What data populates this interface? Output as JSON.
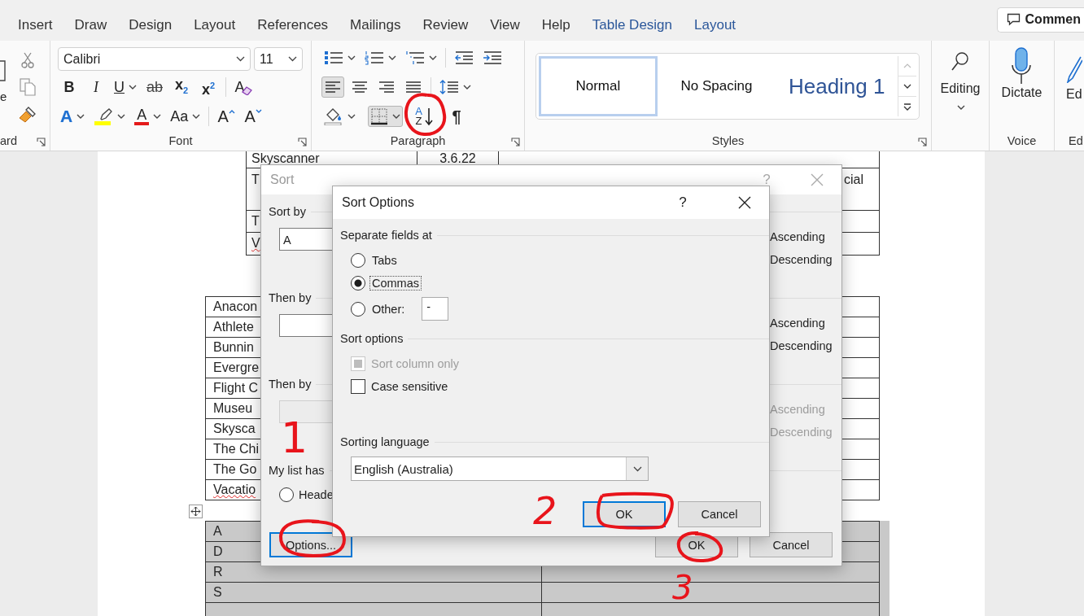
{
  "ribbon_tabs": [
    {
      "label": "Insert",
      "contextual": false
    },
    {
      "label": "Draw",
      "contextual": false
    },
    {
      "label": "Design",
      "contextual": false
    },
    {
      "label": "Layout",
      "contextual": false
    },
    {
      "label": "References",
      "contextual": false
    },
    {
      "label": "Mailings",
      "contextual": false
    },
    {
      "label": "Review",
      "contextual": false
    },
    {
      "label": "View",
      "contextual": false
    },
    {
      "label": "Help",
      "contextual": false
    },
    {
      "label": "Table Design",
      "contextual": true
    },
    {
      "label": "Layout",
      "contextual": true
    }
  ],
  "comments_button": {
    "label": "Commen"
  },
  "ribbon": {
    "clipboard": {
      "paste_label": "e",
      "group_label": "ard"
    },
    "font": {
      "font_name": "Calibri",
      "font_size": "11",
      "group_label": "Font",
      "row_1": [
        {
          "kind": "bold",
          "label": "B",
          "menu": false
        },
        {
          "kind": "italic",
          "label": "I",
          "menu": false
        },
        {
          "kind": "underline",
          "label": "U",
          "menu": true
        },
        {
          "kind": "strike",
          "label": "ab",
          "menu": false
        },
        {
          "kind": "subscript",
          "label": "x$_{2}$",
          "menu": false
        },
        {
          "kind": "superscript",
          "label": "x$^{2}$",
          "menu": false
        },
        {
          "kind": "clear_format",
          "label": "A",
          "menu": false
        }
      ],
      "row_2": [
        {
          "kind": "text_effects",
          "label": "A",
          "menu": true
        },
        {
          "kind": "highlight",
          "menu": true
        },
        {
          "kind": "font_color",
          "label": "A",
          "menu": true
        },
        {
          "kind": "change_case",
          "label": "Aa",
          "menu": true
        },
        {
          "kind": "grow",
          "label": "A",
          "menu": false
        },
        {
          "kind": "shrink",
          "label": "A",
          "menu": false
        }
      ]
    },
    "paragraph": {
      "group_label": "Paragraph",
      "row_1": [
        {
          "kind": "bullets",
          "menu": true
        },
        {
          "kind": "numbering",
          "menu": true
        },
        {
          "kind": "multilevel",
          "menu": true
        },
        {
          "kind": "outdent",
          "menu": false
        },
        {
          "kind": "indent",
          "menu": false
        }
      ],
      "row_2": [
        {
          "kind": "align_left",
          "menu": false,
          "selected": true
        },
        {
          "kind": "align_center",
          "menu": false,
          "selected": false
        },
        {
          "kind": "align_right",
          "menu": false,
          "selected": false
        },
        {
          "kind": "justify",
          "menu": false,
          "selected": false
        },
        {
          "kind": "line_spacing",
          "menu": true
        }
      ],
      "row_3": [
        {
          "kind": "shading",
          "menu": true
        },
        {
          "kind": "borders",
          "menu": true,
          "selected": true
        },
        {
          "kind": "sort",
          "label": "A",
          "label_2": "Z",
          "menu": false
        },
        {
          "kind": "show_marks",
          "label": "¶",
          "menu": false,
          "selected": false
        }
      ]
    },
    "styles": {
      "group_label": "Styles",
      "items": [
        {
          "name": "Normal",
          "kind": "body",
          "selected": true
        },
        {
          "name": "No Spacing",
          "kind": "body",
          "selected": false
        },
        {
          "name": "Heading 1",
          "kind": "heading",
          "selected": false
        }
      ]
    },
    "editing": {
      "label": "Editing"
    },
    "voice": {
      "label": "Dictate",
      "group_label": "Voice"
    },
    "editor": {
      "label": "Ed",
      "group_label": "Ed"
    }
  },
  "document": {
    "table_1": {
      "rows": [
        {
          "cells": [
            "Skyscanner",
            "3.6.22"
          ],
          "misspelled": false
        },
        {
          "cells": [
            "T"
          ],
          "tail": "cial",
          "misspelled": false
        },
        {
          "cells": [
            "T"
          ],
          "misspelled": false
        },
        {
          "cells": [
            "V"
          ],
          "misspelled": true
        }
      ]
    },
    "table_2": {
      "rows": [
        {
          "text": "Anacon",
          "misspelled": false
        },
        {
          "text": "Athlete",
          "misspelled": false
        },
        {
          "text": "Bunnin",
          "misspelled": false
        },
        {
          "text": "Evergre",
          "misspelled": false
        },
        {
          "text": "Flight C",
          "misspelled": false
        },
        {
          "text": "Museu",
          "misspelled": false
        },
        {
          "text": "Skysca",
          "misspelled": false
        },
        {
          "text": "The Chi",
          "misspelled": false
        },
        {
          "text": "The Go",
          "misspelled": false
        },
        {
          "text": "Vacatio",
          "misspelled": true
        }
      ]
    },
    "table_3": {
      "selected": true,
      "rows": [
        "A",
        "D",
        "R",
        "S"
      ]
    }
  },
  "sort_dialog": {
    "title": "Sort",
    "active": false,
    "help_label": "?",
    "keys": [
      {
        "label": "Sort by",
        "value": "A",
        "disabled": false,
        "ascending_label": "Ascending",
        "descending_label": "Descending"
      },
      {
        "label": "Then by",
        "disabled": false,
        "ascending_label": "Ascending",
        "descending_label": "Descending"
      },
      {
        "label": "Then by",
        "disabled": true,
        "ascending_label": "Ascending",
        "descending_label": "Descending"
      }
    ],
    "list_label": "My list has",
    "header_option": {
      "label": "Heade",
      "selected": false
    },
    "buttons": [
      {
        "label": "Options...",
        "focused": true
      },
      {
        "label": "OK",
        "focused": false
      },
      {
        "label": "Cancel",
        "focused": false
      }
    ]
  },
  "sort_options_dialog": {
    "title": "Sort Options",
    "help_label": "?",
    "separator": {
      "label": "Separate fields at",
      "options": [
        {
          "label": "Tabs",
          "selected": false
        },
        {
          "label": "Commas",
          "selected": true
        },
        {
          "label": "Other:",
          "selected": false
        }
      ],
      "other_value": "-"
    },
    "sort_options": {
      "label": "Sort options",
      "checks": [
        {
          "label": "Sort column only",
          "checked": true,
          "disabled": true
        },
        {
          "label": "Case sensitive",
          "checked": false,
          "disabled": false
        }
      ]
    },
    "language": {
      "label": "Sorting language",
      "value": "English (Australia)"
    },
    "buttons": [
      {
        "label": "OK",
        "focused": true
      },
      {
        "label": "Cancel",
        "focused": false
      }
    ]
  },
  "annotations": [
    {
      "label": "1"
    },
    {
      "label": "2"
    },
    {
      "label": "3"
    }
  ]
}
